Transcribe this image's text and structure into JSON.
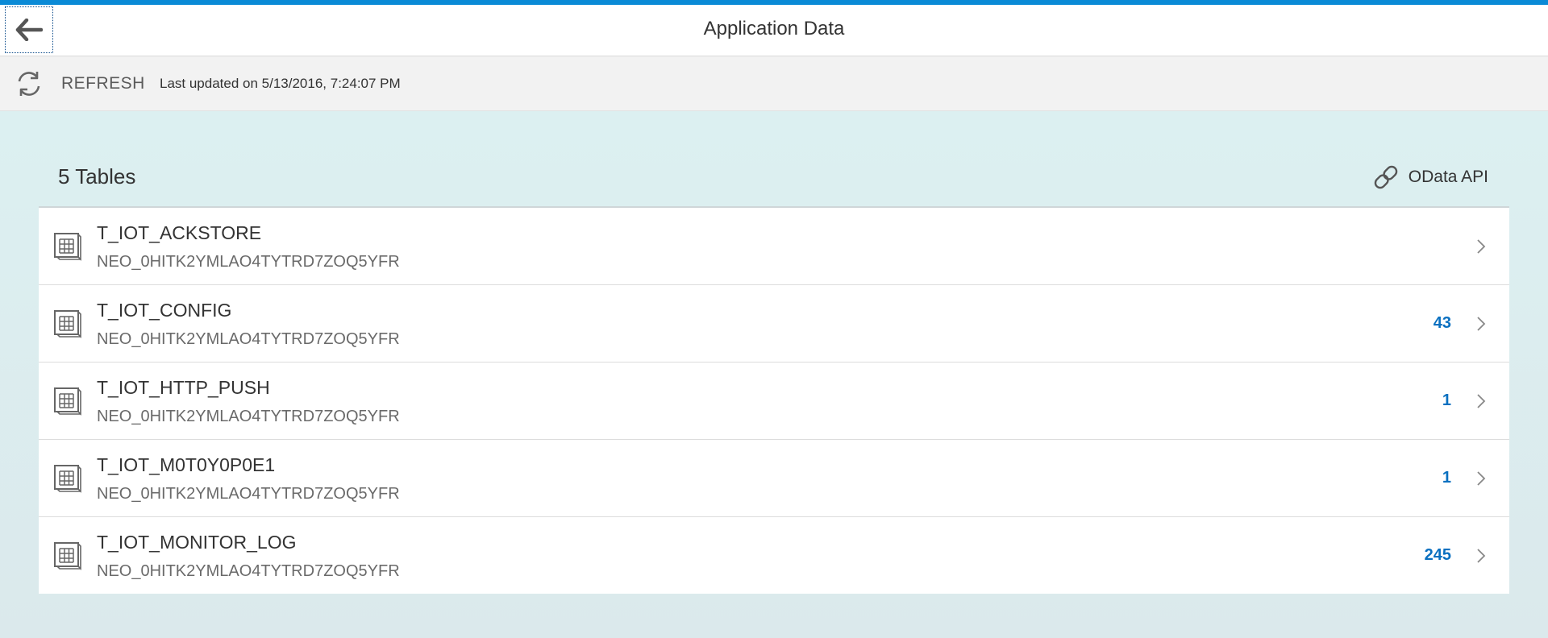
{
  "header": {
    "title": "Application Data",
    "back_icon": "arrow-left-icon"
  },
  "toolbar": {
    "refresh_label": "REFRESH",
    "last_updated": "Last updated on 5/13/2016, 7:24:07 PM",
    "refresh_icon": "refresh-icon"
  },
  "panel": {
    "title": "5 Tables",
    "odata_label": "OData API",
    "odata_icon": "link-icon"
  },
  "tables": [
    {
      "name": "T_IOT_ACKSTORE",
      "schema": "NEO_0HITK2YMLAO4TYTRD7ZOQ5YFR",
      "count": ""
    },
    {
      "name": "T_IOT_CONFIG",
      "schema": "NEO_0HITK2YMLAO4TYTRD7ZOQ5YFR",
      "count": "43"
    },
    {
      "name": "T_IOT_HTTP_PUSH",
      "schema": "NEO_0HITK2YMLAO4TYTRD7ZOQ5YFR",
      "count": "1"
    },
    {
      "name": "T_IOT_M0T0Y0P0E1",
      "schema": "NEO_0HITK2YMLAO4TYTRD7ZOQ5YFR",
      "count": "1"
    },
    {
      "name": "T_IOT_MONITOR_LOG",
      "schema": "NEO_0HITK2YMLAO4TYTRD7ZOQ5YFR",
      "count": "245"
    }
  ],
  "colors": {
    "accent": "#0a8ad6",
    "count": "#0a70c0",
    "background": "#dcf0f1"
  }
}
